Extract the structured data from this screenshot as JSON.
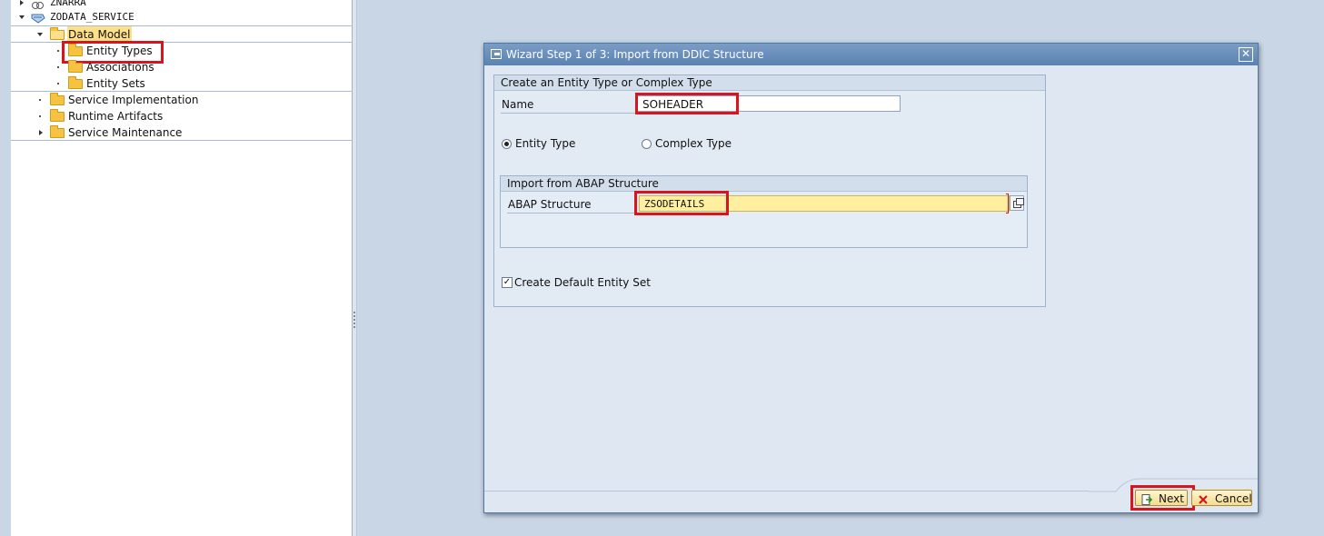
{
  "tree": {
    "items": [
      {
        "label": "ZNARRA"
      },
      {
        "label": "ZODATA_SERVICE"
      },
      {
        "label": "Data Model"
      },
      {
        "label": "Entity Types"
      },
      {
        "label": "Associations"
      },
      {
        "label": "Entity Sets"
      },
      {
        "label": "Service Implementation"
      },
      {
        "label": "Runtime Artifacts"
      },
      {
        "label": "Service Maintenance"
      }
    ]
  },
  "dialog": {
    "title": "Wizard Step 1 of 3: Import from DDIC Structure",
    "close_glyph": "✕",
    "group_create": {
      "header": "Create an Entity Type or Complex Type",
      "name_label": "Name",
      "name_value": "SOHEADER",
      "radio_entity_type": "Entity Type",
      "radio_complex_type": "Complex Type",
      "selected_type": "Entity Type",
      "import_group": {
        "header": "Import from ABAP Structure",
        "abap_label": "ABAP Structure",
        "abap_value": "ZSODETAILS"
      },
      "checkbox_label": "Create Default Entity Set",
      "checkbox_checked": true,
      "check_glyph": "✓"
    },
    "buttons": {
      "next_label": "Next",
      "cancel_label": "Cancel"
    }
  },
  "colors": {
    "highlight_box": "#d8141f",
    "title_bar": "#5b82b2",
    "input_focus": "#ffef9f",
    "folder": "#f5c242"
  },
  "icons": [
    "expand-arrow-icon",
    "collapse-arrow-icon",
    "service-icon",
    "folder-icon",
    "folder-open-icon",
    "dialog-window-icon",
    "close-icon",
    "value-help-icon",
    "next-arrow-icon",
    "cancel-x-icon"
  ]
}
